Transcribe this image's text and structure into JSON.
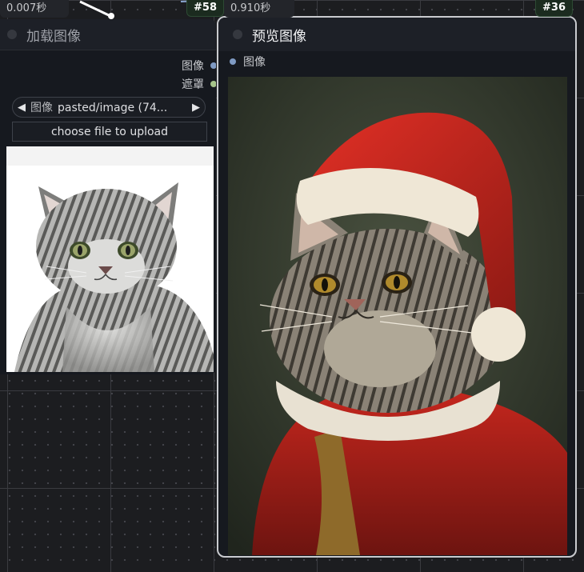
{
  "load_node": {
    "timing": "0.007秒",
    "id_badge": "#58",
    "title": "加载图像",
    "outputs": [
      {
        "label": "图像",
        "color": "#7f9ac3"
      },
      {
        "label": "遮罩",
        "color": "#a6c48a"
      }
    ],
    "image_widget": {
      "name": "图像",
      "value": "pasted/image (74...",
      "prev_icon": "triangle-left-icon",
      "next_icon": "triangle-right-icon"
    },
    "upload_button": "choose file to upload"
  },
  "preview_node": {
    "timing": "0.910秒",
    "id_badge": "#36",
    "title": "预览图像",
    "input": {
      "label": "图像",
      "color": "#7f9ac3"
    }
  },
  "colors": {
    "canvas_bg": "#1c1d20",
    "node_bg": "#16191f",
    "selected_outline": "#c9cbcf",
    "link_color": "#ffffff"
  }
}
